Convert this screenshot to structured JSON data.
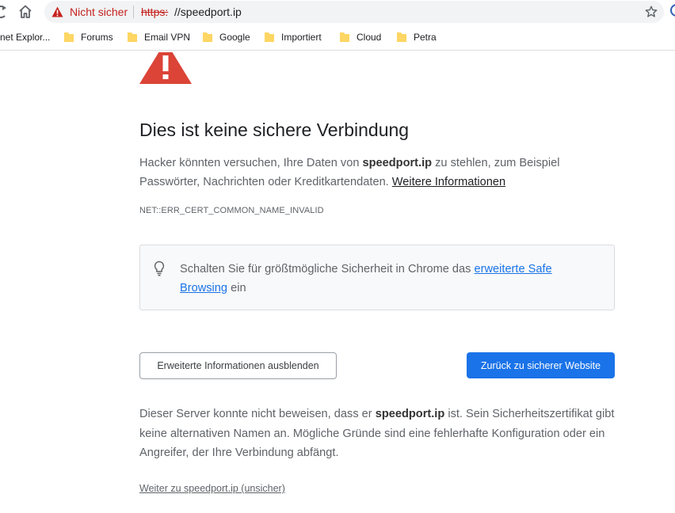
{
  "browser": {
    "security_label": "Nicht sicher",
    "url_scheme": "https:",
    "url_rest": "//speedport.ip"
  },
  "bookmarks": [
    {
      "label": "net Explor..."
    },
    {
      "label": "Forums"
    },
    {
      "label": "Email VPN"
    },
    {
      "label": "Google"
    },
    {
      "label": "Importiert"
    },
    {
      "label": "Cloud"
    },
    {
      "label": "Petra"
    }
  ],
  "page": {
    "title": "Dies ist keine sichere Verbindung",
    "message_before": "Hacker könnten versuchen, Ihre Daten von ",
    "message_host": "speedport.ip",
    "message_after": " zu stehlen, zum Beispiel Passwörter, Nachrichten oder Kreditkartendaten. ",
    "learn_more": "Weitere Informationen",
    "error_code": "NET::ERR_CERT_COMMON_NAME_INVALID",
    "safe_text_before": "Schalten Sie für größtmögliche Sicherheit in Chrome das ",
    "safe_link": "erweiterte Safe Browsing",
    "safe_text_after": " ein",
    "details_button": "Erweiterte Informationen ausblenden",
    "back_button": "Zurück zu sicherer Website",
    "details_before": "Dieser Server konnte nicht beweisen, dass er ",
    "details_host": "speedport.ip",
    "details_after": " ist. Sein Sicherheitszertifikat gibt keine alternativen Namen an. Mögliche Gründe sind eine fehlerhafte Konfiguration oder ein Angreifer, der Ihre Verbindung abfängt.",
    "proceed_link": "Weiter zu speedport.ip (unsicher)"
  },
  "colors": {
    "danger": "#c5221f",
    "primary": "#1a73e8",
    "warning_triangle": "#db4437",
    "folder": "#fdd663"
  }
}
